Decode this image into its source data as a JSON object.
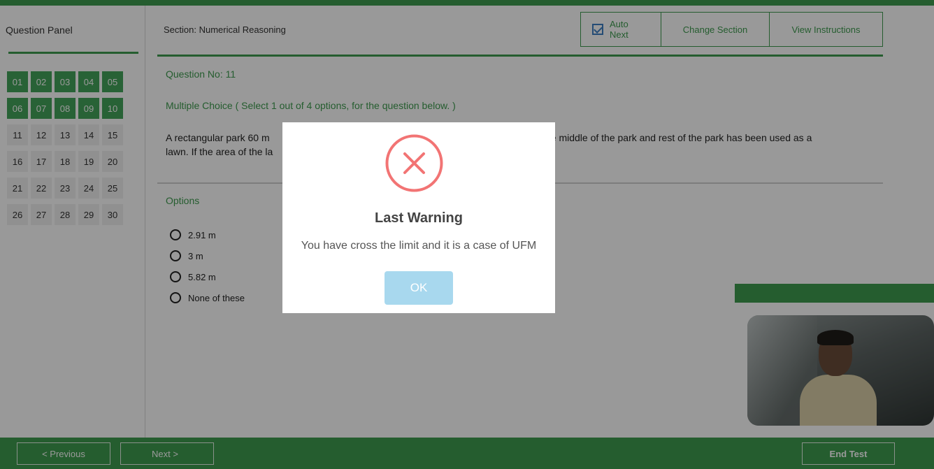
{
  "left_panel": {
    "title": "Question Panel",
    "questions": [
      {
        "label": "01",
        "status": "answered"
      },
      {
        "label": "02",
        "status": "answered"
      },
      {
        "label": "03",
        "status": "answered"
      },
      {
        "label": "04",
        "status": "answered"
      },
      {
        "label": "05",
        "status": "answered"
      },
      {
        "label": "06",
        "status": "answered"
      },
      {
        "label": "07",
        "status": "answered"
      },
      {
        "label": "08",
        "status": "answered"
      },
      {
        "label": "09",
        "status": "answered"
      },
      {
        "label": "10",
        "status": "answered"
      },
      {
        "label": "11",
        "status": "unanswered"
      },
      {
        "label": "12",
        "status": "unanswered"
      },
      {
        "label": "13",
        "status": "unanswered"
      },
      {
        "label": "14",
        "status": "unanswered"
      },
      {
        "label": "15",
        "status": "unanswered"
      },
      {
        "label": "16",
        "status": "unanswered"
      },
      {
        "label": "17",
        "status": "unanswered"
      },
      {
        "label": "18",
        "status": "unanswered"
      },
      {
        "label": "19",
        "status": "unanswered"
      },
      {
        "label": "20",
        "status": "unanswered"
      },
      {
        "label": "21",
        "status": "unanswered"
      },
      {
        "label": "22",
        "status": "unanswered"
      },
      {
        "label": "23",
        "status": "unanswered"
      },
      {
        "label": "24",
        "status": "unanswered"
      },
      {
        "label": "25",
        "status": "unanswered"
      },
      {
        "label": "26",
        "status": "unanswered"
      },
      {
        "label": "27",
        "status": "unanswered"
      },
      {
        "label": "28",
        "status": "unanswered"
      },
      {
        "label": "29",
        "status": "unanswered"
      },
      {
        "label": "30",
        "status": "unanswered"
      }
    ]
  },
  "header": {
    "section": "Section: Numerical Reasoning",
    "auto_next_label": "Auto Next",
    "auto_next_checked": true,
    "change_section_label": "Change Section",
    "view_instructions_label": "View Instructions"
  },
  "question": {
    "number": "Question No: 11",
    "type": "Multiple Choice ( Select 1 out of 4 options, for the question below. )",
    "text_line1": "A rectangular park 60 m",
    "text_line1_end": "g in the middle of the park and rest of the park has been used as a",
    "text_line2": "lawn. If the area of the la",
    "options_label": "Options",
    "options": [
      "2.91 m",
      "3 m",
      "5.82 m",
      "None of these"
    ]
  },
  "footer": {
    "previous_label": "< Previous",
    "next_label": "Next >",
    "end_label": "End Test"
  },
  "modal": {
    "title": "Last Warning",
    "message": "You have cross the limit and it is a case of UFM",
    "ok_label": "OK"
  },
  "colors": {
    "brand_green": "#3e9b4f",
    "answered_green": "#44a35b",
    "error_red": "#f27474",
    "ok_blue": "#a8d8ee"
  },
  "icons": {
    "modal_icon": "error-x-circle-icon",
    "auto_next_icon": "checkbox-checked-icon"
  }
}
